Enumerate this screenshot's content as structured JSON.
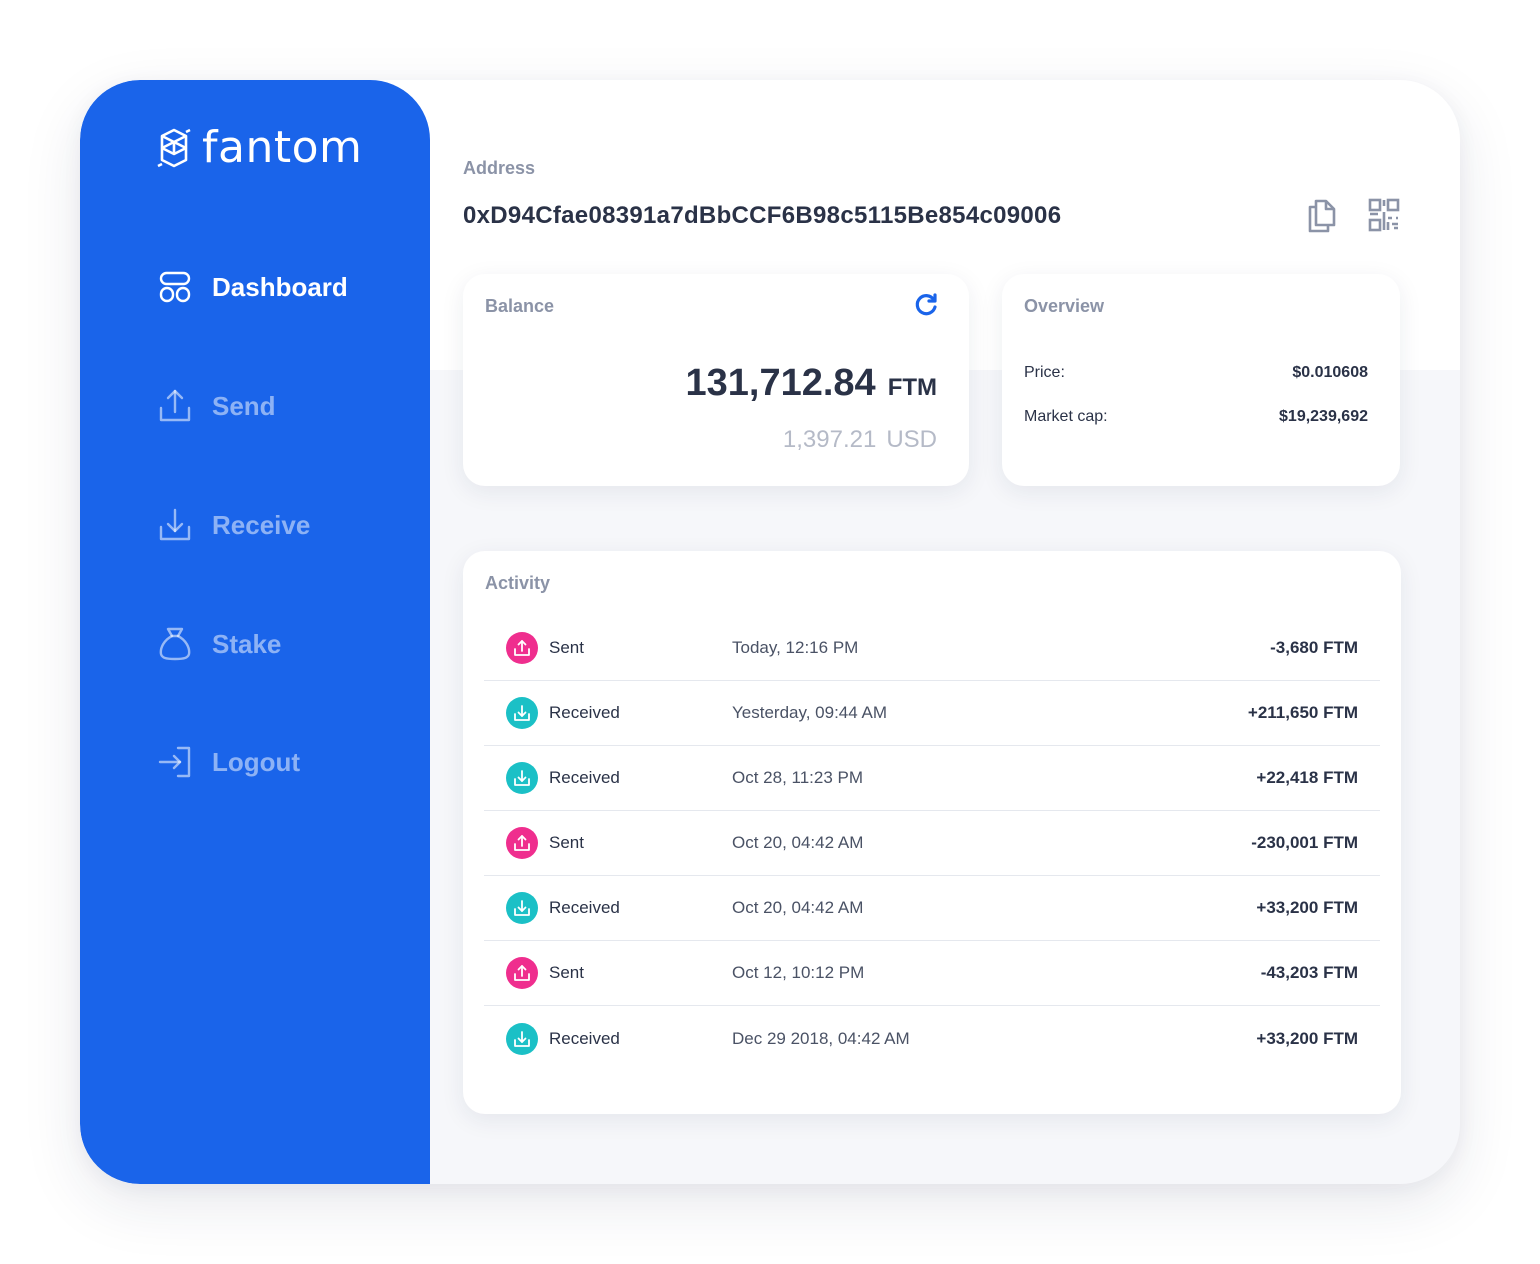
{
  "app": {
    "brand": "fantom"
  },
  "sidebar": {
    "items": [
      {
        "label": "Dashboard",
        "icon": "dashboard-icon",
        "active": true
      },
      {
        "label": "Send",
        "icon": "upload-icon",
        "active": false
      },
      {
        "label": "Receive",
        "icon": "download-icon",
        "active": false
      },
      {
        "label": "Stake",
        "icon": "money-bag-icon",
        "active": false
      },
      {
        "label": "Logout",
        "icon": "logout-icon",
        "active": false
      }
    ]
  },
  "address": {
    "label": "Address",
    "value": "0xD94Cfae08391a7dBbCCF6B98c5115Be854c09006",
    "copy_icon": "copy-icon",
    "qr_icon": "qr-code-icon"
  },
  "balance": {
    "title": "Balance",
    "amount": "131,712.84",
    "unit": "FTM",
    "usd_amount": "1,397.21",
    "usd_unit": "USD",
    "refresh_icon": "refresh-icon"
  },
  "overview": {
    "title": "Overview",
    "rows": [
      {
        "label": "Price:",
        "value": "$0.010608"
      },
      {
        "label": "Market cap:",
        "value": "$19,239,692"
      }
    ]
  },
  "activity": {
    "title": "Activity",
    "rows": [
      {
        "type": "Sent",
        "kind": "sent",
        "date": "Today, 12:16 PM",
        "amount": "-3,680 FTM"
      },
      {
        "type": "Received",
        "kind": "received",
        "date": "Yesterday, 09:44 AM",
        "amount": "+211,650 FTM"
      },
      {
        "type": "Received",
        "kind": "received",
        "date": "Oct 28, 11:23 PM",
        "amount": "+22,418 FTM"
      },
      {
        "type": "Sent",
        "kind": "sent",
        "date": "Oct 20, 04:42 AM",
        "amount": "-230,001 FTM"
      },
      {
        "type": "Received",
        "kind": "received",
        "date": "Oct 20, 04:42 AM",
        "amount": "+33,200 FTM"
      },
      {
        "type": "Sent",
        "kind": "sent",
        "date": "Oct 12, 10:12 PM",
        "amount": "-43,203 FTM"
      },
      {
        "type": "Received",
        "kind": "received",
        "date": "Dec 29 2018, 04:42 AM",
        "amount": "+33,200 FTM"
      }
    ]
  },
  "colors": {
    "sidebar": "#1a64ea",
    "sent": "#ef2e8e",
    "received": "#1bc0c6",
    "text_dark": "#2a3247",
    "text_muted": "#8b93a7"
  }
}
